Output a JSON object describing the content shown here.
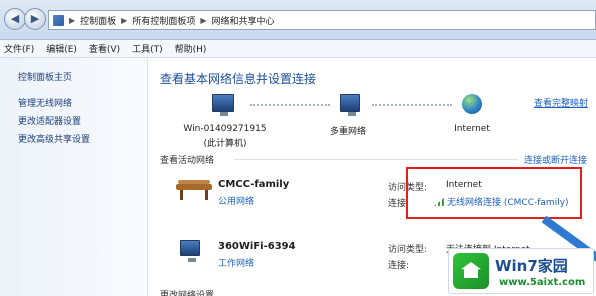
{
  "address": {
    "crumbs": [
      "控制面板",
      "所有控制面板项",
      "网络和共享中心"
    ],
    "separator": "▶"
  },
  "menu": [
    "文件(F)",
    "编辑(E)",
    "查看(V)",
    "工具(T)",
    "帮助(H)"
  ],
  "left_pane": {
    "home": "控制面板主页",
    "links": [
      "管理无线网络",
      "更改适配器设置",
      "更改高级共享设置"
    ]
  },
  "main": {
    "title": "查看基本网络信息并设置连接",
    "full_map_link": "查看完整映射",
    "nodes": [
      {
        "label": "Win-01409271915",
        "sublabel": "(此计算机)"
      },
      {
        "label": "多重网络"
      },
      {
        "label": "Internet"
      }
    ],
    "active_header": "查看活动网络",
    "connect_link": "连接或断开连接",
    "networks": [
      {
        "name": "CMCC-family",
        "type": "公用网络",
        "access_label": "访问类型:",
        "access_value": "Internet",
        "conn_label": "连接:",
        "conn_value": "无线网络连接 (CMCC-family)"
      },
      {
        "name": "360WiFi-6394",
        "type": "工作网络",
        "access_label": "访问类型:",
        "access_value": "无法连接到 Internet",
        "conn_label": "连接:"
      }
    ],
    "bottom_header": "更改网络设置"
  },
  "watermark": {
    "title": "Win7家园",
    "url": "www.5aixt.com"
  },
  "colors": {
    "accent_link": "#1f5fbf",
    "highlight_box": "#e0201c",
    "arrow": "#2d7ad0"
  }
}
